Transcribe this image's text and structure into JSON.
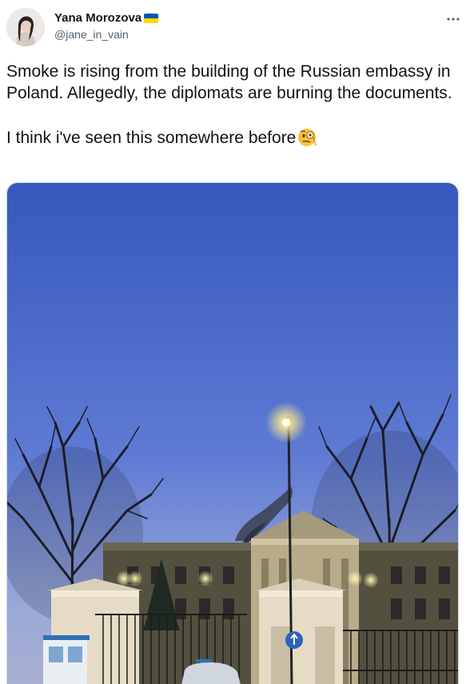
{
  "author": {
    "display_name": "Yana Morozova",
    "handle": "@jane_in_vain",
    "verified_flag": "ukraine-flag"
  },
  "tweet": {
    "text": "Smoke is rising from the building of the Russian embassy in Poland. Allegedly, the diplomats are burning the documents.\n\nI think i've seen this somewhere before",
    "emoji": "face-with-monocle"
  },
  "photo": {
    "description_icon": "embassy-photo"
  },
  "colors": {
    "text": "#0f1419",
    "secondary": "#536471",
    "sky_top": "#3a5fc4",
    "sky_bottom": "#8a9ed8"
  }
}
